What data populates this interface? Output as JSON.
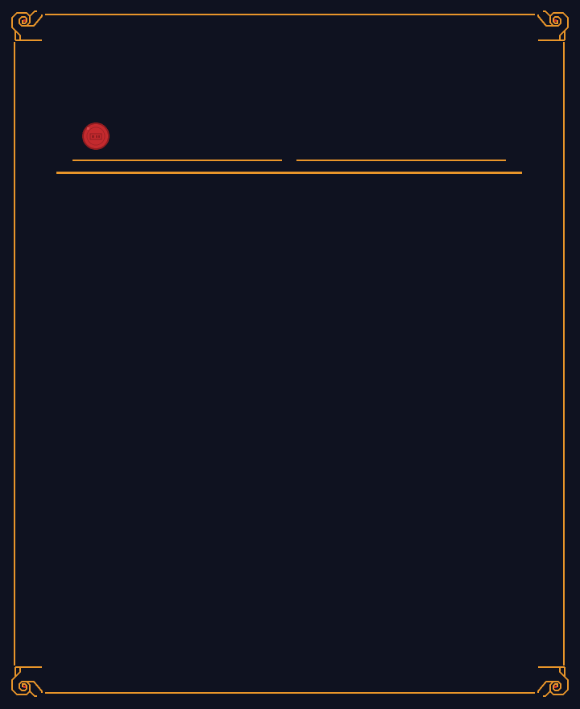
{
  "screen": {
    "name": "parchment-panel",
    "background_color": "#0f1220",
    "frame_color": "#e8952a",
    "accent_color": "#c42a2e"
  },
  "ornaments": {
    "corner_icon": "spiral-corner-ornament-icon",
    "seal_icon": "wax-seal-icon"
  },
  "content": {
    "title": "",
    "subtitle": "",
    "body_text": ""
  }
}
